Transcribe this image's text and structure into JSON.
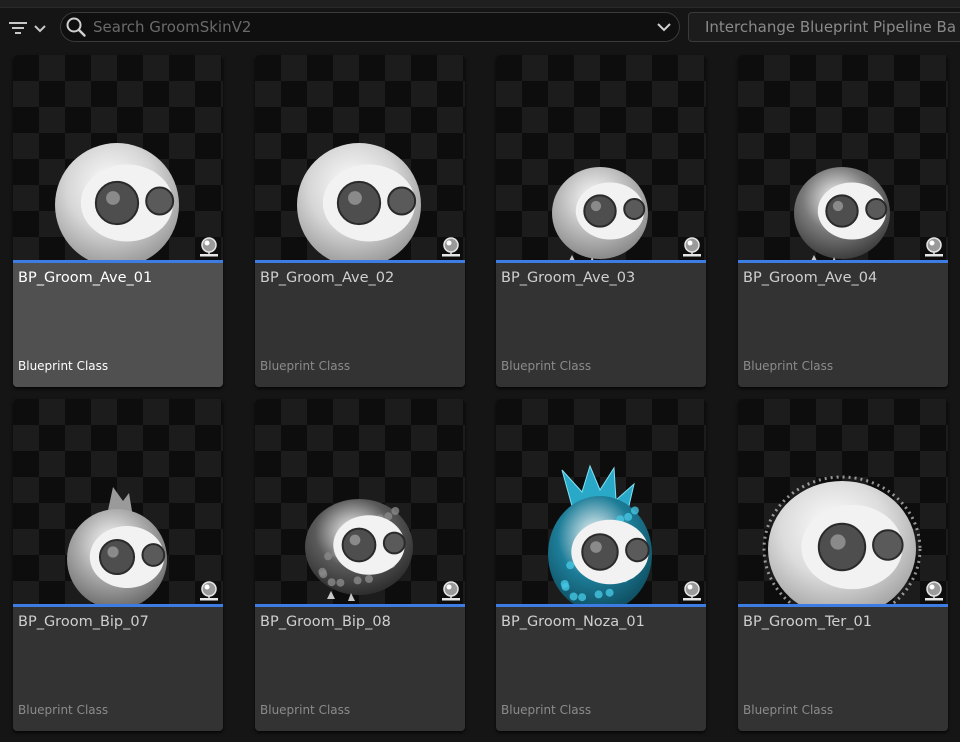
{
  "toolbar": {
    "search_placeholder": "Search GroomSkinV2",
    "pipeline_label": "Interchange Blueprint Pipeline Ba"
  },
  "assets": [
    {
      "name": "BP_Groom_Ave_01",
      "type": "Blueprint Class",
      "variant": "smooth",
      "selected": true
    },
    {
      "name": "BP_Groom_Ave_02",
      "type": "Blueprint Class",
      "variant": "smooth",
      "selected": false
    },
    {
      "name": "BP_Groom_Ave_03",
      "type": "Blueprint Class",
      "variant": "small",
      "selected": false
    },
    {
      "name": "BP_Groom_Ave_04",
      "type": "Blueprint Class",
      "variant": "dark",
      "selected": false
    },
    {
      "name": "BP_Groom_Bip_07",
      "type": "Blueprint Class",
      "variant": "crest",
      "selected": false
    },
    {
      "name": "BP_Groom_Bip_08",
      "type": "Blueprint Class",
      "variant": "scaly",
      "selected": false
    },
    {
      "name": "BP_Groom_Noza_01",
      "type": "Blueprint Class",
      "variant": "crystal",
      "selected": false
    },
    {
      "name": "BP_Groom_Ter_01",
      "type": "Blueprint Class",
      "variant": "fluffy",
      "selected": false
    }
  ],
  "colors": {
    "accent_bar": "#3d7de3",
    "tile_bg": "#333333",
    "tile_selected_bg": "#505050",
    "crystal": "#2aa8c8"
  },
  "icons": {
    "filter": "filter-icon",
    "search": "search-icon",
    "dropdown": "chevron-down-icon",
    "thumbnail_badge": "camera-view-icon"
  }
}
